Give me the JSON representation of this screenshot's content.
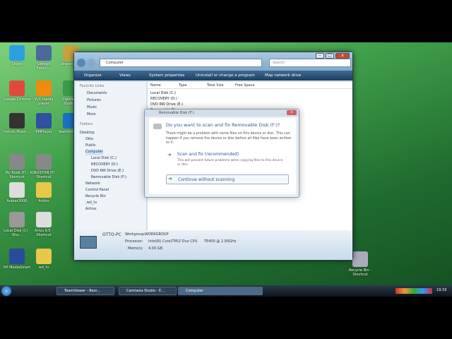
{
  "desktop": {
    "icons": [
      {
        "label": "Skype",
        "color": "#2aa0e0"
      },
      {
        "label": "Linksys EasyLi...",
        "color": "#4a6a9a"
      },
      {
        "label": "Desperate...",
        "color": "#c9a040"
      },
      {
        "label": "Google Chrome",
        "color": "#e04a3a"
      },
      {
        "label": "VLC media player",
        "color": "#f08a10"
      },
      {
        "label": "Camtasia Studio 6",
        "color": "#3a9a4a"
      },
      {
        "label": "Helium Music ...",
        "color": "#333"
      },
      {
        "label": "KMPlayer",
        "color": "#3050a0"
      },
      {
        "label": "TeamViewer 7",
        "color": "#1a70c0"
      },
      {
        "label": "My Book (F) - Shortcut",
        "color": "#888"
      },
      {
        "label": "KINGSTON (F) - Shortcut",
        "color": "#888"
      },
      {
        "label": "foobar2000",
        "color": "#ddd"
      },
      {
        "label": "Arhivs",
        "color": "#e8c84a"
      },
      {
        "label": "Local Disk (C) - Sho...",
        "color": "#999"
      },
      {
        "label": "Arivu 9.5 - Shortcut",
        "color": "#ddd"
      },
      {
        "label": "HP MediaSmart",
        "color": "#2a4a9a"
      },
      {
        "label": "wd_tv",
        "color": "#e8c84a"
      },
      {
        "label": "Recycle Bin - Shortcut",
        "color": "#aab"
      }
    ]
  },
  "window": {
    "breadcrumb": "Computer",
    "search_placeholder": "Search",
    "toolbar": {
      "organize": "Organize",
      "views": "Views",
      "system_properties": "System properties",
      "uninstall": "Uninstall or change a program",
      "map_drive": "Map network drive"
    },
    "nav": {
      "favorite_links": "Favorite Links",
      "documents": "Documents",
      "pictures": "Pictures",
      "music": "Music",
      "more": "More",
      "folders": "Folders",
      "tree": [
        "Desktop",
        "Otto",
        "Public",
        "Computer",
        "Local Disk (C:)",
        "RECOVERY (D:)",
        "DVD RW Drive (E:)",
        "Removable Disk (F:)",
        "Network",
        "Control Panel",
        "Recycle Bin",
        ".wd_tv",
        "Arhivs"
      ]
    },
    "columns": {
      "name": "Name",
      "type": "Type",
      "total_size": "Total Size",
      "free_space": "Free Space"
    },
    "drives": [
      "Local Disk (C:)",
      "RECOVERY (D:)",
      "DVD RW Drive (E:)",
      "Removable Di..."
    ],
    "details": {
      "pc_name": "OTTO-PC",
      "workgroup_label": "Workgroup:",
      "workgroup": "WORKGROUP",
      "processor_label": "Processor:",
      "processor": "Intel(R) Core(TM)2 Duo CPU",
      "processor_model": "T6400 @ 2.00GHz",
      "memory_label": "Memory:",
      "memory": "4.00 GB"
    }
  },
  "dialog": {
    "title": "Removable Disk (F:)",
    "heading": "Do you want to scan and fix Removable Disk (F:)?",
    "body": "There might be a problem with some files on this device or disc. This can happen if you remove the device or disc before all files have been written to it.",
    "opt1_title": "Scan and fix (recommended)",
    "opt1_desc": "This will prevent future problems when copying files to this device or disc.",
    "opt2_title": "Continue without scanning"
  },
  "taskbar": {
    "items": [
      "TeamViewer - Bezr...",
      "Camtasia Studio - E...",
      "Computer"
    ],
    "clock": "19:33"
  }
}
